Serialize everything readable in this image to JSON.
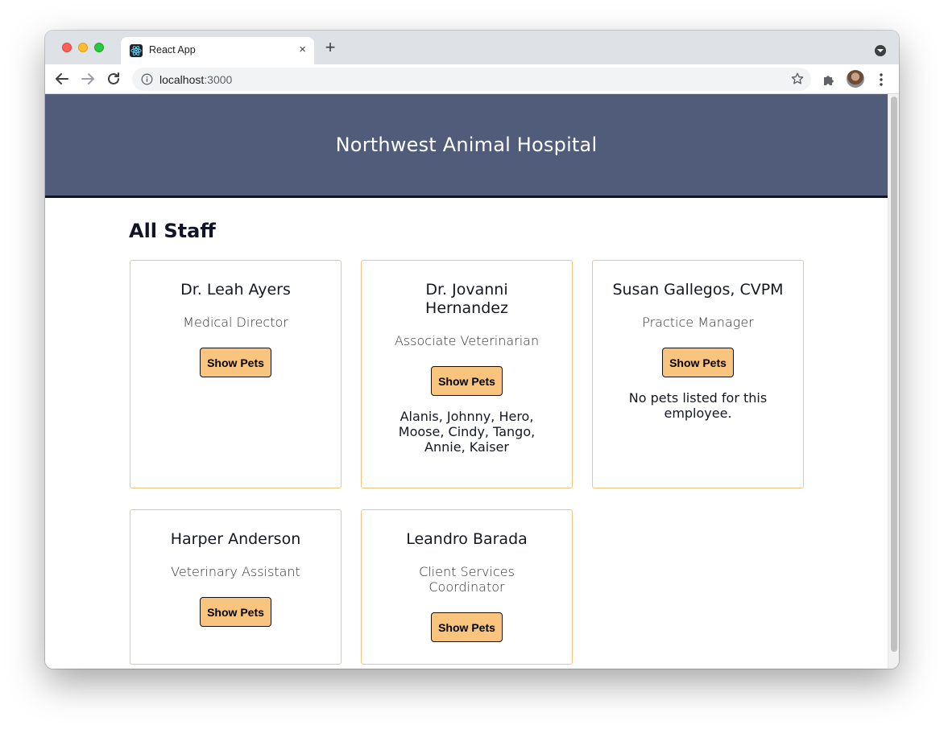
{
  "browser": {
    "tab_title": "React App",
    "tab_close": "×",
    "new_tab": "+",
    "url_host": "localhost",
    "url_port": ":3000"
  },
  "page": {
    "title": "Northwest Animal Hospital",
    "section_title": "All Staff",
    "button_label": "Show Pets"
  },
  "staff": [
    {
      "name": "Dr. Leah Ayers",
      "role": "Medical Director",
      "pets": ""
    },
    {
      "name": "Dr. Jovanni Hernandez",
      "role": "Associate Veterinarian",
      "pets": "Alanis, Johnny, Hero, Moose, Cindy, Tango, Annie, Kaiser"
    },
    {
      "name": "Susan Gallegos, CVPM",
      "role": "Practice Manager",
      "pets": "No pets listed for this employee."
    },
    {
      "name": "Harper Anderson",
      "role": "Veterinary Assistant",
      "pets": ""
    },
    {
      "name": "Leandro Barada",
      "role": "Client Services Coordinator",
      "pets": ""
    }
  ],
  "colors": {
    "banner": "#505c79",
    "card_border": "#f7c57e",
    "button": "#f8c47e"
  }
}
